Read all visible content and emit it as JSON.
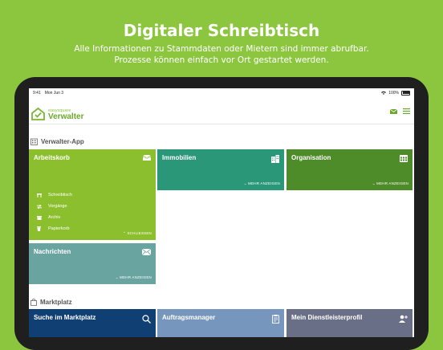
{
  "hero": {
    "title": "Digitaler Schreibtisch",
    "subtitle_line1": "Alle Informationen zu Stammdaten oder Mietern sind immer abrufbar.",
    "subtitle_line2": "Prozesse können einfach vor Ort gestartet werden."
  },
  "statusbar": {
    "time": "9:41",
    "date": "Mon Jun 3",
    "battery": "100%"
  },
  "app": {
    "logo_small": "easysquare",
    "logo_big": "Verwalter"
  },
  "sections": {
    "verwalter": "Verwalter-App",
    "marktplatz": "Marktplatz"
  },
  "tiles": {
    "arbeitskorb": {
      "title": "Arbeitskorb",
      "items": [
        "Schreibtisch",
        "Vorgänge",
        "Archiv",
        "Papierkorb"
      ],
      "action": "⌃ SCHLIESSEN"
    },
    "immobilien": {
      "title": "Immobilien",
      "action": "⌄ MEHR ANZEIGEN"
    },
    "organisation": {
      "title": "Organisation",
      "action": "⌄ MEHR ANZEIGEN"
    },
    "nachrichten": {
      "title": "Nachrichten",
      "action": "⌄ MEHR ANZEIGEN"
    },
    "suche": {
      "title": "Suche im Marktplatz"
    },
    "auftrag": {
      "title": "Auftragsmanager"
    },
    "dienstleister": {
      "title": "Mein Dienstleisterprofil"
    }
  },
  "colors": {
    "background": "#8cc63e",
    "arbeitskorb": "#8cbf2e",
    "immobilien": "#2a9878",
    "organisation": "#4e8c2a",
    "nachrichten": "#6aa4a0",
    "suche": "#0f3f73",
    "auftrag": "#7796bd",
    "dienstleister": "#6a6f88"
  }
}
